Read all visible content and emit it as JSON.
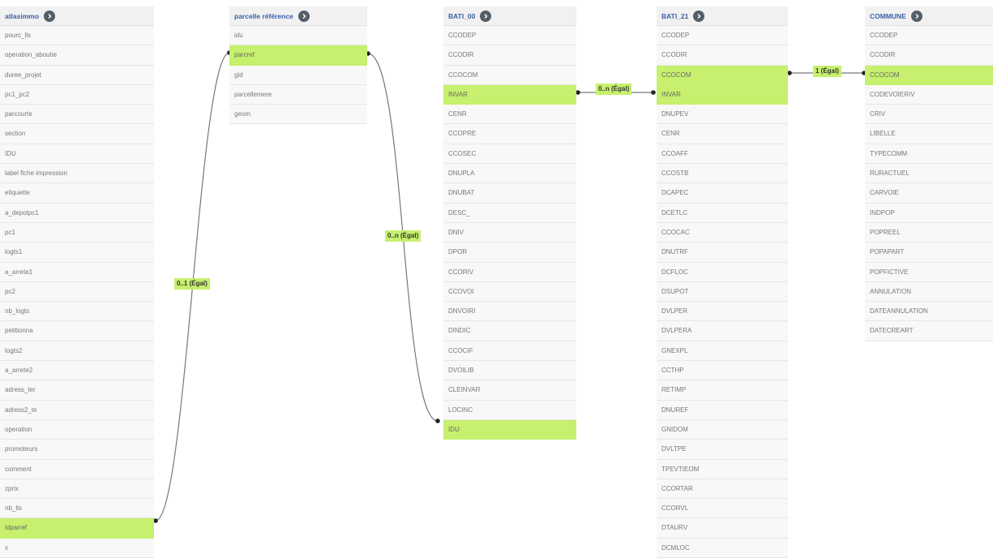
{
  "tables": {
    "atlasimmo": {
      "title": "atlasimmo",
      "fields": [
        "pourc_lls",
        "operation_aboutie",
        "duree_projet",
        "pc1_pc2",
        "parcourte",
        "section",
        "IDU",
        "label fiche impression",
        "etiquette",
        "a_depotpc1",
        "pc1",
        "logts1",
        "a_arrete1",
        "pc2",
        "nb_logts",
        "petitionna",
        "logts2",
        "a_arrete2",
        "adress_ter",
        "adress2_te",
        "operation",
        "promoteurs",
        "comment",
        "zprix",
        "nb_lls",
        "idparref",
        "x"
      ],
      "highlighted": [
        "idparref"
      ]
    },
    "parcelle": {
      "title": "parcelle référence",
      "fields": [
        "idu",
        "parcref",
        "gid",
        "parcellemere",
        "geom"
      ],
      "highlighted": [
        "parcref"
      ]
    },
    "bati00": {
      "title": "BATI_00",
      "fields": [
        "CCODEP",
        "CCODIR",
        "CCOCOM",
        "INVAR",
        "CENR",
        "CCOPRE",
        "CCOSEC",
        "DNUPLA",
        "DNUBAT",
        "DESC_",
        "DNIV",
        "DPOR",
        "CCORIV",
        "CCOVOI",
        "DNVOIRI",
        "DINDIC",
        "CCOCIF",
        "DVOILIB",
        "CLEINVAR",
        "LOCINC",
        "IDU"
      ],
      "highlighted": [
        "INVAR",
        "IDU"
      ]
    },
    "bati21": {
      "title": "BATI_21",
      "fields": [
        "CCODEP",
        "CCODIR",
        "CCOCOM",
        "INVAR",
        "DNUPEV",
        "CENR",
        "CCOAFF",
        "CCOSTB",
        "DCAPEC",
        "DCETLC",
        "CCOCAC",
        "DNUTRF",
        "DCFLOC",
        "DSUPOT",
        "DVLPER",
        "DVLPERA",
        "GNEXPL",
        "CCTHP",
        "RETIMP",
        "DNUREF",
        "GNIDOM",
        "DVLTPE",
        "TPEVTIEOM",
        "CCORTAR",
        "CCORVL",
        "DTAURV",
        "DCMLOC"
      ],
      "highlighted": [
        "CCOCOM",
        "INVAR"
      ]
    },
    "commune": {
      "title": "COMMUNE",
      "fields": [
        "CCODEP",
        "CCODIR",
        "CCOCOM",
        "CODEVOIERIV",
        "CRIV",
        "LIBELLE",
        "TYPECOMM",
        "RURACTUEL",
        "CARVOIE",
        "INDPOP",
        "POPREEL",
        "POPAPART",
        "POPFICTIVE",
        "ANNULATION",
        "DATEANNULATION",
        "DATECREART"
      ],
      "highlighted": [
        "CCOCOM"
      ]
    }
  },
  "relations": [
    {
      "from": "atlasimmo.idparref",
      "to": "parcelle.parcref",
      "label": "0..1 (Égal)"
    },
    {
      "from": "parcelle.parcref",
      "to": "bati00.IDU",
      "label": "0..n (Égal)"
    },
    {
      "from": "bati00.INVAR",
      "to": "bati21.INVAR",
      "label": "0..n (Égal)"
    },
    {
      "from": "bati21.CCOCOM",
      "to": "commune.CCOCOM",
      "label": "1 (Égal)"
    }
  ],
  "icons": {
    "table_toggle": "chevron-right-icon"
  },
  "colors": {
    "highlight": "#c6f06d",
    "title": "#3a5fa8",
    "icon": "#555e66"
  }
}
